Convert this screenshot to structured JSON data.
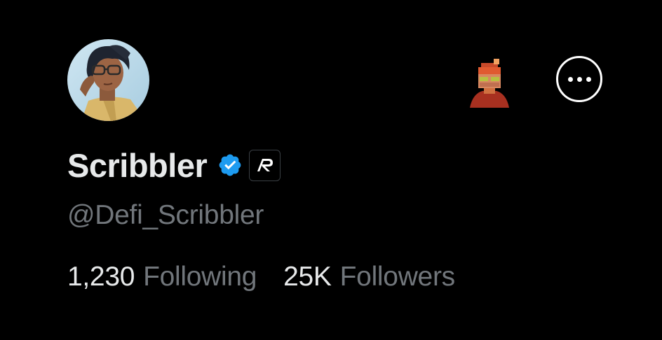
{
  "profile": {
    "display_name": "Scribbler",
    "handle": "@Defi_Scribbler",
    "avatar_icon": "anime-avatar-with-glasses",
    "verified_icon": "verified-badge-icon",
    "affiliate_badge_icon": "ar-logo-icon",
    "affiliate_avatar_icon": "pixel-character-avatar",
    "more_icon": "more-options-icon"
  },
  "stats": {
    "following_count": "1,230",
    "following_label": "Following",
    "followers_count": "25K",
    "followers_label": "Followers"
  },
  "colors": {
    "background": "#000000",
    "primary_text": "#e7e9ea",
    "secondary_text": "#71767b",
    "verified_blue": "#1d9bf0"
  }
}
